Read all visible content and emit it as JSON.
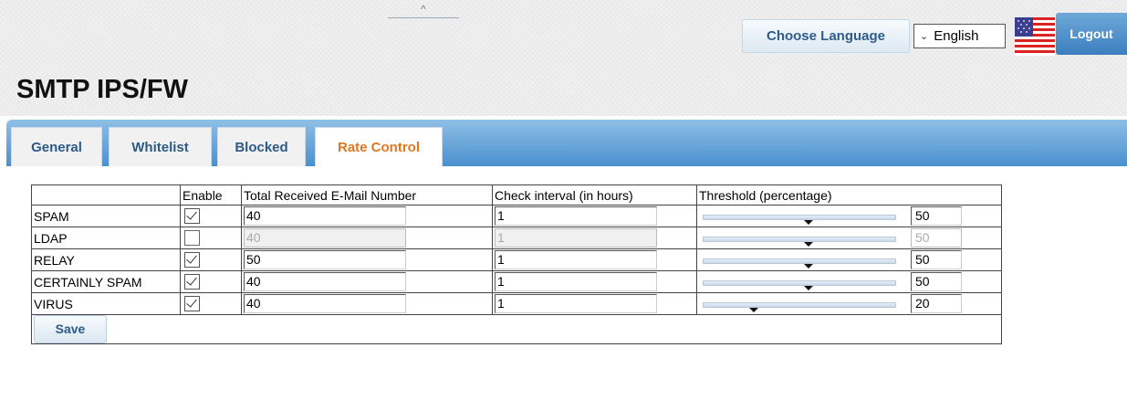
{
  "header": {
    "collapse_glyph": "^",
    "choose_language_label": "Choose Language",
    "language_selected": "English",
    "logout_label": "Logout"
  },
  "page_title": "SMTP IPS/FW",
  "tabs": [
    {
      "label": "General",
      "active": false
    },
    {
      "label": "Whitelist",
      "active": false
    },
    {
      "label": "Blocked",
      "active": false
    },
    {
      "label": "Rate Control",
      "active": true
    }
  ],
  "table": {
    "headers": [
      "",
      "Enable",
      "Total Received E-Mail Number",
      "Check interval (in hours)",
      "Threshold (percentage)"
    ],
    "rows": [
      {
        "label": "SPAM",
        "enabled": true,
        "total": "40",
        "interval": "1",
        "threshold": 50
      },
      {
        "label": "LDAP",
        "enabled": false,
        "total": "40",
        "interval": "1",
        "threshold": 50
      },
      {
        "label": "RELAY",
        "enabled": true,
        "total": "50",
        "interval": "1",
        "threshold": 50
      },
      {
        "label": "CERTAINLY SPAM",
        "enabled": true,
        "total": "40",
        "interval": "1",
        "threshold": 50
      },
      {
        "label": "VIRUS",
        "enabled": true,
        "total": "40",
        "interval": "1",
        "threshold": 20
      }
    ]
  },
  "save_label": "Save",
  "colors": {
    "tab_bar": "#4a90cf",
    "active_tab_text": "#e0781f",
    "tab_text": "#2d5a87"
  },
  "icons": {
    "flag": "us-flag-icon",
    "collapse": "chevron-up-icon",
    "dropdown": "chevron-down-icon",
    "checkbox": "checkmark-icon",
    "slider_thumb": "slider-thumb-icon"
  }
}
